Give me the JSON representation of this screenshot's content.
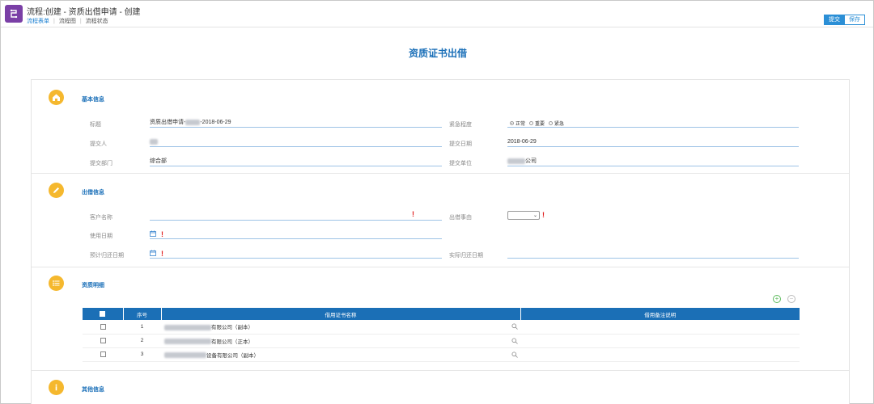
{
  "header": {
    "flow_title": "流程:创建 - 资质出借申请 - 创建",
    "tabs": [
      {
        "label": "流程表单",
        "active": true
      },
      {
        "label": "流程图",
        "active": false
      },
      {
        "label": "流程状态",
        "active": false
      }
    ],
    "submit_label": "提交",
    "save_label": "保存"
  },
  "page_title": "资质证书出借",
  "basic": {
    "title": "基本信息",
    "subject_label": "标题",
    "subject_prefix": "资质出借申请-",
    "subject_suffix": "-2018-06-29",
    "urgency_label": "紧急程度",
    "urgency_options": [
      {
        "label": "正常",
        "selected": true
      },
      {
        "label": "重要",
        "selected": false
      },
      {
        "label": "紧急",
        "selected": false
      }
    ],
    "submitter_label": "提交人",
    "submit_date_label": "提交日期",
    "submit_date_value": "2018-06-29",
    "dept_label": "提交部门",
    "dept_value": "综合部",
    "unit_label": "提交单位",
    "unit_suffix": "公司"
  },
  "loan": {
    "title": "出借信息",
    "customer_label": "客户名称",
    "reason_label": "出借事由",
    "use_date_label": "使用日期",
    "return_date_label": "预计归还日期",
    "actual_return_label": "实际归还日期"
  },
  "detail": {
    "title": "资质明细",
    "columns": [
      "序号",
      "借用证书名称",
      "借用备注说明"
    ],
    "rows": [
      {
        "no": "1",
        "name_suffix": "有限公司（副本）"
      },
      {
        "no": "2",
        "name_suffix": "有限公司（正本）"
      },
      {
        "no": "3",
        "name_suffix": "设备有限公司（副本）"
      }
    ]
  },
  "other": {
    "title": "其他信息"
  },
  "colors": {
    "accent": "#1a6fb8",
    "section_icon": "#f5b82e",
    "required": "#e02020",
    "table_header": "#1b6fb6"
  }
}
